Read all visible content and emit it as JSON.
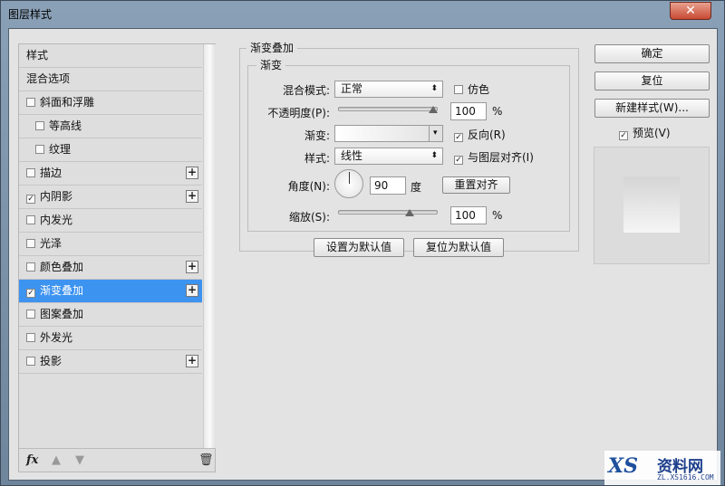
{
  "window": {
    "title": "图层样式",
    "close": "✕"
  },
  "styles_list": {
    "items": [
      {
        "label": "样式",
        "checkbox": null,
        "indent": false,
        "plus": false,
        "selected": false
      },
      {
        "label": "混合选项",
        "checkbox": null,
        "indent": false,
        "plus": false,
        "selected": false
      },
      {
        "label": "斜面和浮雕",
        "checkbox": false,
        "indent": false,
        "plus": false,
        "selected": false
      },
      {
        "label": "等高线",
        "checkbox": false,
        "indent": true,
        "plus": false,
        "selected": false
      },
      {
        "label": "纹理",
        "checkbox": false,
        "indent": true,
        "plus": false,
        "selected": false
      },
      {
        "label": "描边",
        "checkbox": false,
        "indent": false,
        "plus": true,
        "selected": false
      },
      {
        "label": "内阴影",
        "checkbox": true,
        "indent": false,
        "plus": true,
        "selected": false
      },
      {
        "label": "内发光",
        "checkbox": false,
        "indent": false,
        "plus": false,
        "selected": false
      },
      {
        "label": "光泽",
        "checkbox": false,
        "indent": false,
        "plus": false,
        "selected": false
      },
      {
        "label": "颜色叠加",
        "checkbox": false,
        "indent": false,
        "plus": true,
        "selected": false
      },
      {
        "label": "渐变叠加",
        "checkbox": true,
        "indent": false,
        "plus": true,
        "selected": true
      },
      {
        "label": "图案叠加",
        "checkbox": false,
        "indent": false,
        "plus": false,
        "selected": false
      },
      {
        "label": "外发光",
        "checkbox": false,
        "indent": false,
        "plus": false,
        "selected": false
      },
      {
        "label": "投影",
        "checkbox": false,
        "indent": false,
        "plus": true,
        "selected": false
      }
    ],
    "footer": {
      "fx": "fx"
    }
  },
  "panel": {
    "section_title": "渐变叠加",
    "group_title": "渐变",
    "blend_mode_label": "混合模式:",
    "blend_mode_value": "正常",
    "dither_label": "仿色",
    "dither_checked": false,
    "opacity_label": "不透明度(P):",
    "opacity_value": "100",
    "opacity_unit": "%",
    "opacity_percent": 100,
    "gradient_label": "渐变:",
    "reverse_label": "反向(R)",
    "reverse_checked": true,
    "style_label": "样式:",
    "style_value": "线性",
    "align_label": "与图层对齐(I)",
    "align_checked": true,
    "angle_label": "角度(N):",
    "angle_value": "90",
    "angle_unit": "度",
    "reset_align": "重置对齐",
    "scale_label": "缩放(S):",
    "scale_value": "100",
    "scale_unit": "%",
    "scale_percent": 100,
    "set_default": "设置为默认值",
    "reset_default": "复位为默认值"
  },
  "right": {
    "ok": "确定",
    "reset": "复位",
    "new_style": "新建样式(W)...",
    "preview_label": "预览(V)",
    "preview_checked": true
  },
  "watermark": {
    "text": "资料网",
    "url_text": "ZL.XS1616.COM"
  },
  "colors": {
    "selected": "#3d93f0",
    "dialog_bg": "#e3e3e3"
  }
}
